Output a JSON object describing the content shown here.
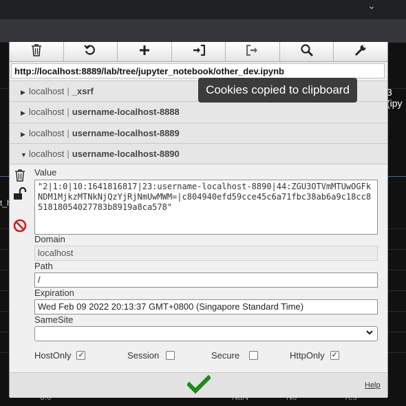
{
  "browser": {
    "extensions": [
      "share-icon",
      "star-icon",
      "cookie-editor-icon",
      "puzzle-icon"
    ]
  },
  "background": {
    "right_fragment": "3 (ipy",
    "left_fragment": "t_h",
    "bottom_texts": [
      "0.0",
      "NaN",
      "No",
      "Yes"
    ]
  },
  "toolbar": {
    "buttons": [
      "trash-icon",
      "reload-icon",
      "plus-icon",
      "import-icon",
      "export-icon",
      "search-icon",
      "wrench-icon"
    ]
  },
  "url": "http://localhost:8889/lab/tree/jupyter_notebook/other_dev.ipynb",
  "toast": "Cookies copied to clipboard",
  "cookies": [
    {
      "domain": "localhost",
      "separator": "|",
      "name": "_xsrf",
      "expanded": false
    },
    {
      "domain": "localhost",
      "separator": "|",
      "name": "username-localhost-8888",
      "expanded": false
    },
    {
      "domain": "localhost",
      "separator": "|",
      "name": "username-localhost-8889",
      "expanded": false
    },
    {
      "domain": "localhost",
      "separator": "|",
      "name": "username-localhost-8890",
      "expanded": true
    }
  ],
  "detail": {
    "value_label": "Value",
    "value": "\"2|1:0|10:1641816817|23:username-localhost-8890|44:ZGU3OTVmMTUwOGFkNDM1MjkzMTNkNjQzYjRjNmUwMWM=|c804940efd59cce45c6a71fbc38ab6a9c18cc851818054027783b8919a8ca578\"",
    "domain_label": "Domain",
    "domain": "localhost",
    "path_label": "Path",
    "path": "/",
    "expiration_label": "Expiration",
    "expiration": "Wed Feb 09 2022 20:13:37 GMT+0800 (Singapore Standard Time)",
    "samesite_label": "SameSite",
    "samesite": "",
    "flags": [
      {
        "label": "HostOnly",
        "checked": true
      },
      {
        "label": "Session",
        "checked": false
      },
      {
        "label": "Secure",
        "checked": false
      },
      {
        "label": "HttpOnly",
        "checked": true
      }
    ]
  },
  "footer": {
    "help": "Help"
  },
  "colors": {
    "accept_green": "#1c8a1c",
    "delete_red": "#d41a1a"
  }
}
